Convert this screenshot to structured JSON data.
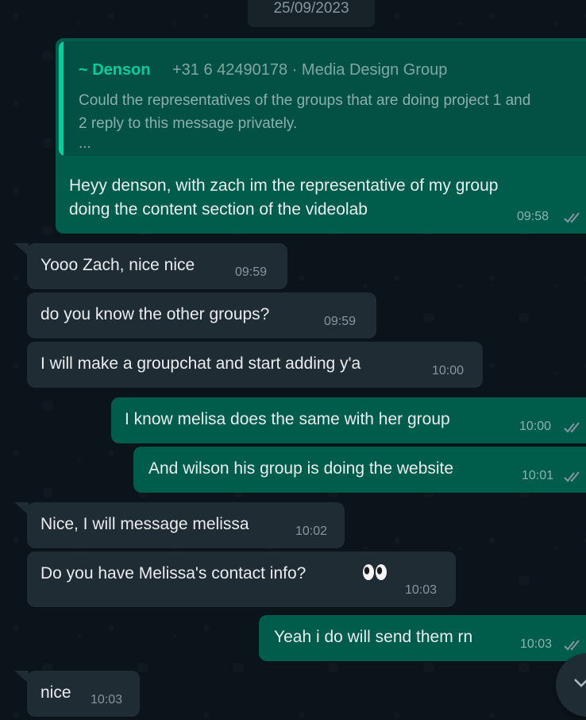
{
  "date_separator": "25/09/2023",
  "quoted_message": {
    "author": "~ Denson",
    "meta": "+31 6 42490178 · Media Design Group",
    "body": "Could the representatives of the groups that are doing project 1 and 2 reply to this message privately.",
    "ellipsis": "..."
  },
  "messages": [
    {
      "direction": "out",
      "line1": "Heyy denson, with zach im the representative of my group",
      "line2": "doing the content section of the videolab",
      "time": "09:58",
      "status": "read"
    },
    {
      "direction": "in",
      "text": "Yooo Zach, nice nice",
      "time": "09:59"
    },
    {
      "direction": "in",
      "text": "do you know the other groups?",
      "time": "09:59"
    },
    {
      "direction": "in",
      "text": "I will make a groupchat and start adding y'a",
      "time": "10:00"
    },
    {
      "direction": "out",
      "text": "I know melisa does the same with her group",
      "time": "10:00",
      "status": "read"
    },
    {
      "direction": "out",
      "text": "And wilson his group is doing the website",
      "time": "10:01",
      "status": "read"
    },
    {
      "direction": "in",
      "text": "Nice, I will message melissa",
      "time": "10:02"
    },
    {
      "direction": "in",
      "text": "Do you have Melissa's contact info?",
      "emoji": "eyes",
      "time": "10:03"
    },
    {
      "direction": "out",
      "text": "Yeah i do will send them rn",
      "time": "10:03",
      "status": "read"
    },
    {
      "direction": "in",
      "text": "nice",
      "time": "10:03"
    }
  ],
  "colors": {
    "background": "#0b141a",
    "incoming_bubble": "#202c33",
    "outgoing_bubble": "#005c4b",
    "quote_accent": "#06cf9c"
  },
  "icons": {
    "read_receipt": "double-check-icon",
    "scroll_down": "chevron-down-icon"
  }
}
